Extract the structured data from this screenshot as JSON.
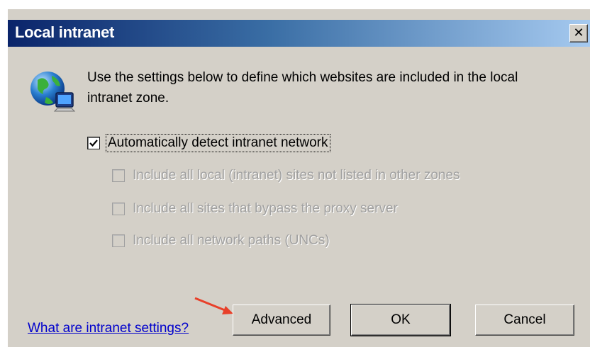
{
  "window": {
    "title": "Local intranet",
    "close_glyph": "✕"
  },
  "icon": {
    "name": "globe-computer-icon"
  },
  "intro_text": "Use the settings below to define which websites are included in the local intranet zone.",
  "checkboxes": [
    {
      "label": "Automatically detect intranet network",
      "checked": true,
      "enabled": true
    },
    {
      "label": "Include all local (intranet) sites not listed in other zones",
      "checked": false,
      "enabled": false
    },
    {
      "label": "Include all sites that bypass the proxy server",
      "checked": false,
      "enabled": false
    },
    {
      "label": "Include all network paths (UNCs)",
      "checked": false,
      "enabled": false
    }
  ],
  "help_link": "What are intranet settings?",
  "buttons": {
    "advanced": "Advanced",
    "ok": "OK",
    "cancel": "Cancel"
  },
  "colors": {
    "dialog_bg": "#d4d0c8",
    "title_start": "#0a246a",
    "title_end": "#a6caf0",
    "link": "#0000cc",
    "annotation_arrow": "#e8402a"
  }
}
